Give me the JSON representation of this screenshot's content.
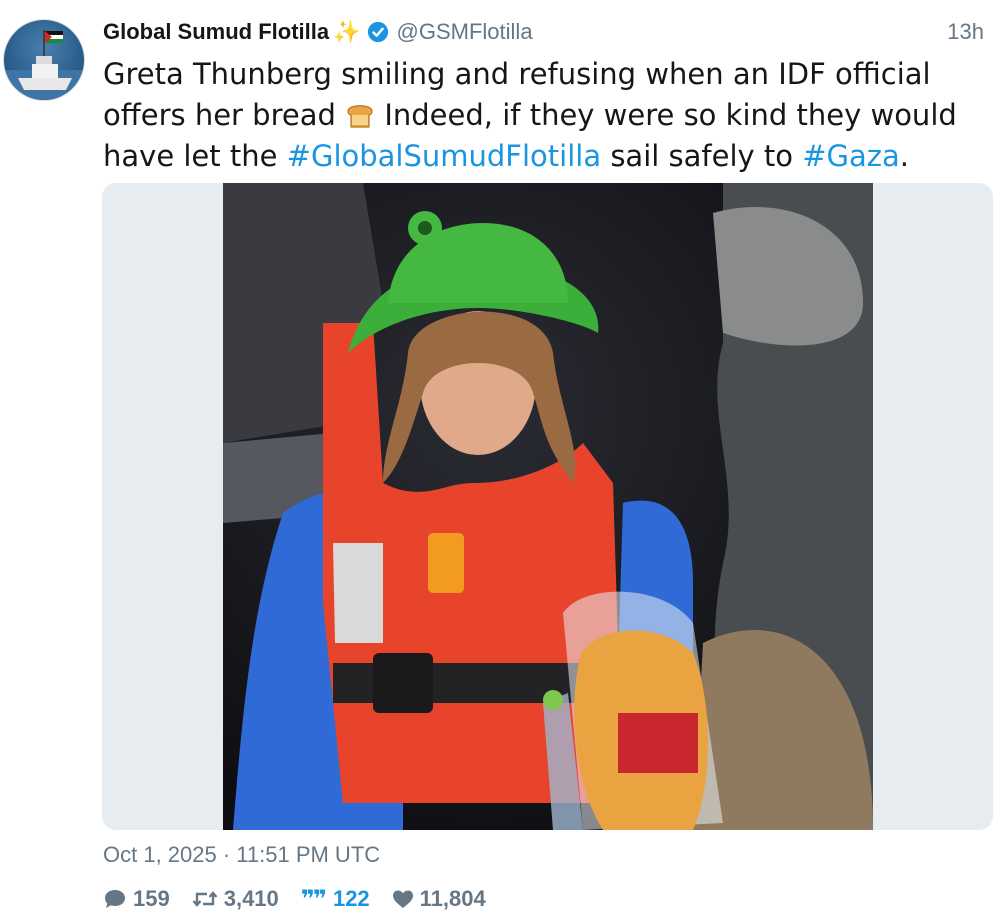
{
  "account": {
    "name": "Global Sumud Flotilla",
    "name_emoji": "✨",
    "handle": "@GSMFlotilla",
    "verified_icon": "verified-badge-icon",
    "avatar": "boat-with-palestinian-flag-avatar"
  },
  "tweet": {
    "relative_time": "13h",
    "text_part1": "Greta Thunberg smiling and refusing when an IDF official offers her bread",
    "emoji": "bread-emoji",
    "text_part2": " Indeed, if they were so kind they would have let the ",
    "hashtag1": "#GlobalSumudFlotilla",
    "text_part3": " sail safely to ",
    "hashtag2": "#Gaza",
    "text_part4": ".",
    "timestamp": "Oct 1, 2025 · 11:51 PM UTC"
  },
  "media": {
    "type": "photo",
    "description_icon": "photo-woman-in-green-hat-and-life-vest"
  },
  "stats": {
    "replies": "159",
    "retweets": "3,410",
    "quotes": "122",
    "likes": "11,804"
  },
  "colors": {
    "link": "#1b95e0",
    "secondary": "#657786",
    "media_background": "#e6ecf0"
  }
}
